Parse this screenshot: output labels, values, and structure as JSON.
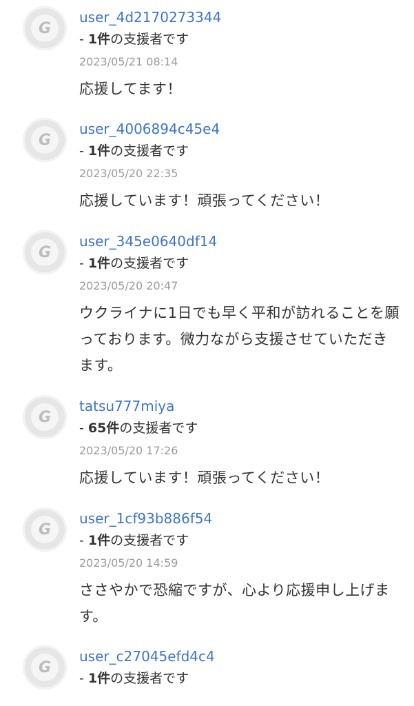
{
  "comments": [
    {
      "avatar_letter": "G",
      "username": "user_4d2170273344",
      "supporter_prefix": "- ",
      "supporter_count": "1件",
      "supporter_suffix": "の支援者です",
      "timestamp": "2023/05/21 08:14",
      "message": "応援してます！"
    },
    {
      "avatar_letter": "G",
      "username": "user_4006894c45e4",
      "supporter_prefix": "- ",
      "supporter_count": "1件",
      "supporter_suffix": "の支援者です",
      "timestamp": "2023/05/20 22:35",
      "message": "応援しています！頑張ってください！"
    },
    {
      "avatar_letter": "G",
      "username": "user_345e0640df14",
      "supporter_prefix": "- ",
      "supporter_count": "1件",
      "supporter_suffix": "の支援者です",
      "timestamp": "2023/05/20 20:47",
      "message": "ウクライナに1日でも早く平和が訪れることを願っております。微力ながら支援させていただきます。"
    },
    {
      "avatar_letter": "G",
      "username": "tatsu777miya",
      "supporter_prefix": "- ",
      "supporter_count": "65件",
      "supporter_suffix": "の支援者です",
      "timestamp": "2023/05/20 17:26",
      "message": "応援しています！頑張ってください！"
    },
    {
      "avatar_letter": "G",
      "username": "user_1cf93b886f54",
      "supporter_prefix": "- ",
      "supporter_count": "1件",
      "supporter_suffix": "の支援者です",
      "timestamp": "2023/05/20 14:59",
      "message": "ささやかで恐縮ですが、心より応援申し上げます。"
    },
    {
      "avatar_letter": "G",
      "username": "user_c27045efd4c4",
      "supporter_prefix": "- ",
      "supporter_count": "1件",
      "supporter_suffix": "の支援者です",
      "timestamp": "",
      "message": ""
    }
  ]
}
